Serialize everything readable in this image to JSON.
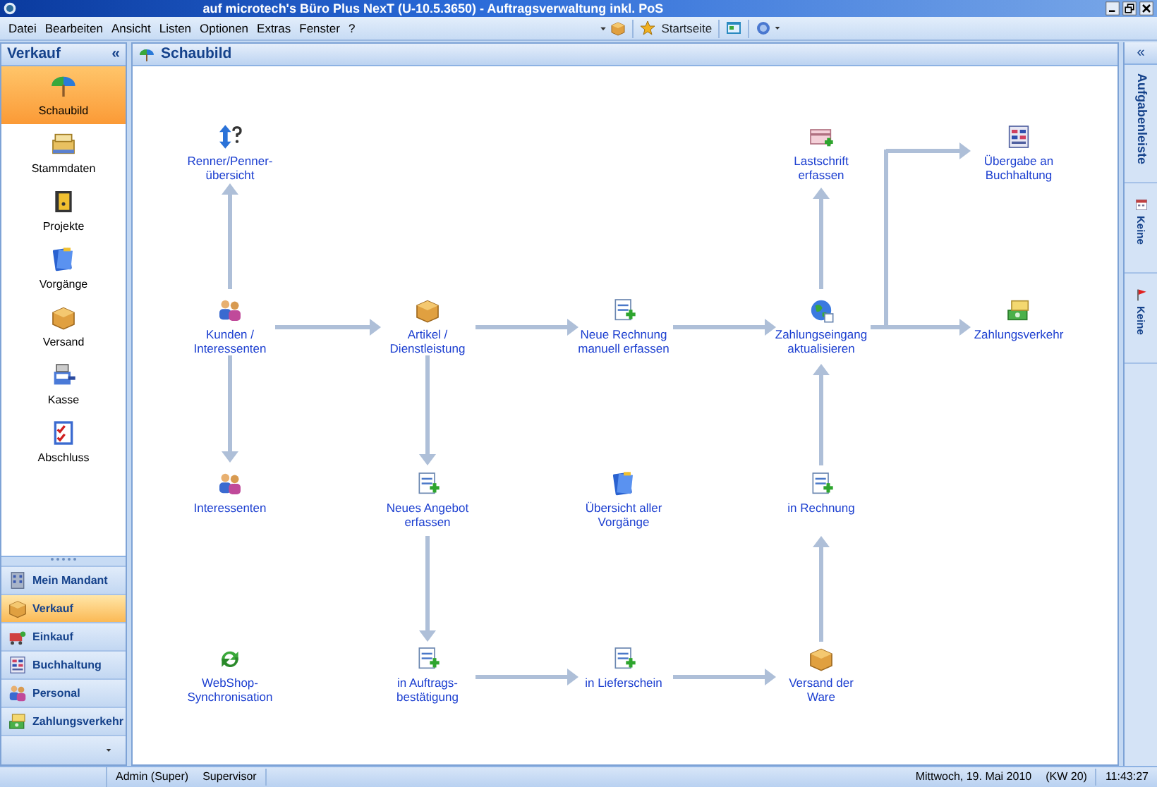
{
  "window": {
    "title": "auf microtech's Büro Plus NexT (U-10.5.3650) - Auftragsverwaltung inkl. PoS"
  },
  "menu": [
    "Datei",
    "Bearbeiten",
    "Ansicht",
    "Listen",
    "Optionen",
    "Extras",
    "Fenster",
    "?"
  ],
  "toolbar": {
    "home_label": "Startseite"
  },
  "sidebar": {
    "title": "Verkauf",
    "collapse": "«",
    "items": [
      {
        "label": "Schaubild",
        "selected": true
      },
      {
        "label": "Stammdaten",
        "selected": false
      },
      {
        "label": "Projekte",
        "selected": false
      },
      {
        "label": "Vorgänge",
        "selected": false
      },
      {
        "label": "Versand",
        "selected": false
      },
      {
        "label": "Kasse",
        "selected": false
      },
      {
        "label": "Abschluss",
        "selected": false
      }
    ],
    "sections": [
      {
        "label": "Mein Mandant",
        "selected": false
      },
      {
        "label": "Verkauf",
        "selected": true
      },
      {
        "label": "Einkauf",
        "selected": false
      },
      {
        "label": "Buchhaltung",
        "selected": false
      },
      {
        "label": "Personal",
        "selected": false
      },
      {
        "label": "Zahlungsverkehr",
        "selected": false
      }
    ]
  },
  "content": {
    "title": "Schaubild",
    "nodes": [
      {
        "label": "Renner/Penner-\nübersicht"
      },
      {
        "label": "Kunden /\nInteressenten"
      },
      {
        "label": "Interessenten"
      },
      {
        "label": "WebShop-\nSynchronisation"
      },
      {
        "label": "Artikel /\nDienstleistung"
      },
      {
        "label": "Neues Angebot\nerfassen"
      },
      {
        "label": "in Auftrags-\nbestätigung"
      },
      {
        "label": "Neue Rechnung\nmanuell erfassen"
      },
      {
        "label": "Übersicht aller\nVorgänge"
      },
      {
        "label": "in Lieferschein"
      },
      {
        "label": "Lastschrift\nerfassen"
      },
      {
        "label": "Zahlungseingang\naktualisieren"
      },
      {
        "label": "in Rechnung"
      },
      {
        "label": "Versand der\nWare"
      },
      {
        "label": "Übergabe an\nBuchhaltung"
      },
      {
        "label": "Zahlungsverkehr"
      }
    ]
  },
  "taskbar": {
    "title": "Aufgabenleiste",
    "collapse": "«",
    "items": [
      "Keine",
      "Keine"
    ]
  },
  "status_bar": {
    "user": "Admin (Super)",
    "role": "Supervisor",
    "date": "Mittwoch, 19. Mai 2010",
    "week": "(KW 20)",
    "time": "11:43:27"
  }
}
